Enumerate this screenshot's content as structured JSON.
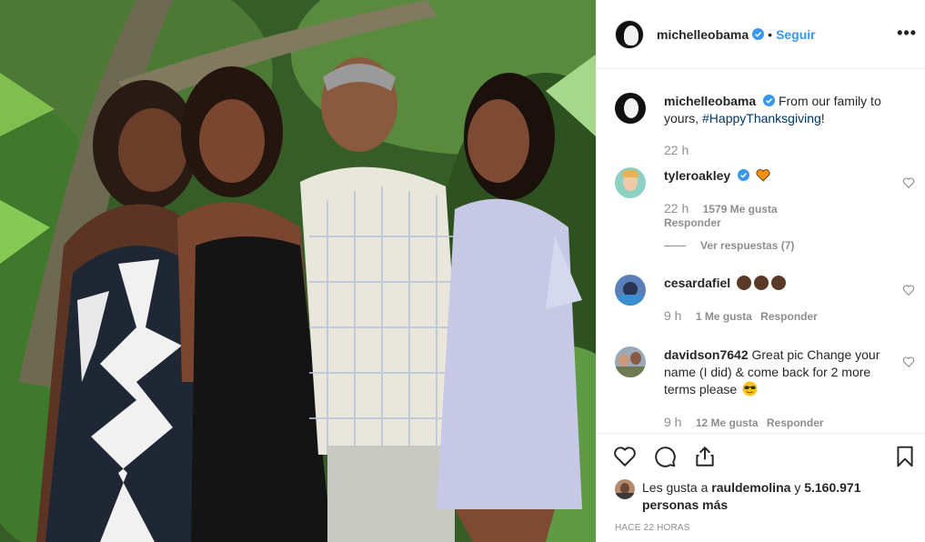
{
  "post": {
    "author": "michelleobama",
    "follow_label": "Seguir",
    "separator": "•",
    "more_label": "•••",
    "caption_user": "michelleobama",
    "caption_text": "From our family to yours,",
    "caption_hashtag": "#HappyThanksgiving",
    "caption_end": "!",
    "caption_time": "22 h"
  },
  "comments": [
    {
      "user": "tyleroakley",
      "text": "",
      "time": "22 h",
      "likes": "1579 Me gusta",
      "reply": "Responder",
      "view_replies": "Ver respuestas (7)"
    },
    {
      "user": "cesardafiel",
      "text": "",
      "time": "9 h",
      "likes": "1 Me gusta",
      "reply": "Responder"
    },
    {
      "user": "davidson7642",
      "text": "Great pic Change your name (I did) & come back for 2 more terms please",
      "time": "9 h",
      "likes": "12 Me gusta",
      "reply": "Responder"
    }
  ],
  "likes": {
    "prefix": "Les gusta a",
    "user": "rauldemolina",
    "conj": "y",
    "count": "5.160.971 personas más"
  },
  "timestamp": "Hace 22 horas",
  "colors": {
    "link": "#3897f0",
    "hashtag": "#003569",
    "muted": "#8e8e8e",
    "text": "#262626",
    "verified": "#3897f0"
  },
  "icons": [
    "verified-badge-icon",
    "more-options-icon",
    "heart-icon",
    "comment-icon",
    "share-icon",
    "bookmark-icon",
    "orange-heart-emoji",
    "sunglasses-emoji",
    "clapping-hands-emoji"
  ]
}
